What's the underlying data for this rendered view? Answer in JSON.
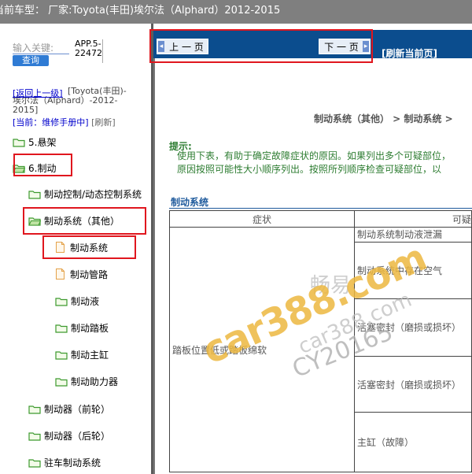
{
  "header": {
    "title": "当前车型：  厂家:Toyota(丰田)埃尔法（Alphard）2012-2015"
  },
  "sidebar": {
    "keyword_label": "输入关键:",
    "search_button": "查询",
    "app_version": "APP.5-\n22472",
    "back_link": "[返回上一级]",
    "back_context": "[Toyota(丰田)-埃尔法（Alphard）-2012-2015]",
    "current_prefix": "[当前：维修手册中]",
    "refresh": "[刷新]",
    "tree": [
      {
        "label": "5.悬架",
        "icon": "folder-icon"
      },
      {
        "label": "6.制动",
        "icon": "folder-open-icon"
      },
      {
        "label": "制动控制/动态控制系统",
        "icon": "folder-icon"
      },
      {
        "label": "制动系统（其他）",
        "icon": "folder-open-icon"
      },
      {
        "label": "制动系统",
        "icon": "document-icon"
      },
      {
        "label": "制动管路",
        "icon": "document-icon"
      },
      {
        "label": "制动液",
        "icon": "folder-icon"
      },
      {
        "label": "制动踏板",
        "icon": "folder-icon"
      },
      {
        "label": "制动主缸",
        "icon": "folder-icon"
      },
      {
        "label": "制动助力器",
        "icon": "folder-icon"
      },
      {
        "label": "制动器（前轮）",
        "icon": "folder-icon"
      },
      {
        "label": "制动器（后轮）",
        "icon": "folder-icon"
      },
      {
        "label": "驻车制动系统",
        "icon": "folder-icon"
      }
    ]
  },
  "nav": {
    "prev_label": "上 一 页",
    "next_label": "下 一 页",
    "refresh_label": "[刷新当前页]"
  },
  "content": {
    "breadcrumb": "制动系统（其他）  > 制动系统  >",
    "hint_title": "提示:",
    "hint_lines": [
      "使用下表，有助于确定故障症状的原因。如果列出多个可疑部位，",
      "原因按照可能性大小顺序列出。按照所列顺序检查可疑部位，以"
    ],
    "section_title": "制动系统",
    "table": {
      "headers": [
        "症状",
        "可疑"
      ],
      "symptom": "踏板位置低或踏板绵软",
      "causes": [
        "制动系统制动液泄漏",
        "制动系统中存在空气",
        "活塞密封（磨损或损坏）",
        "活塞密封（磨损或损坏）",
        "主缸（故障）"
      ]
    }
  },
  "watermark": {
    "brand": "畅易",
    "site": "car388.com",
    "code": "CY20165",
    "site2": "car388.com"
  },
  "colors": {
    "nav_bg": "#0b4d8e",
    "highlight": "#e0161e",
    "hint_green": "#2e7d32",
    "section_blue": "#1e5a9c"
  }
}
